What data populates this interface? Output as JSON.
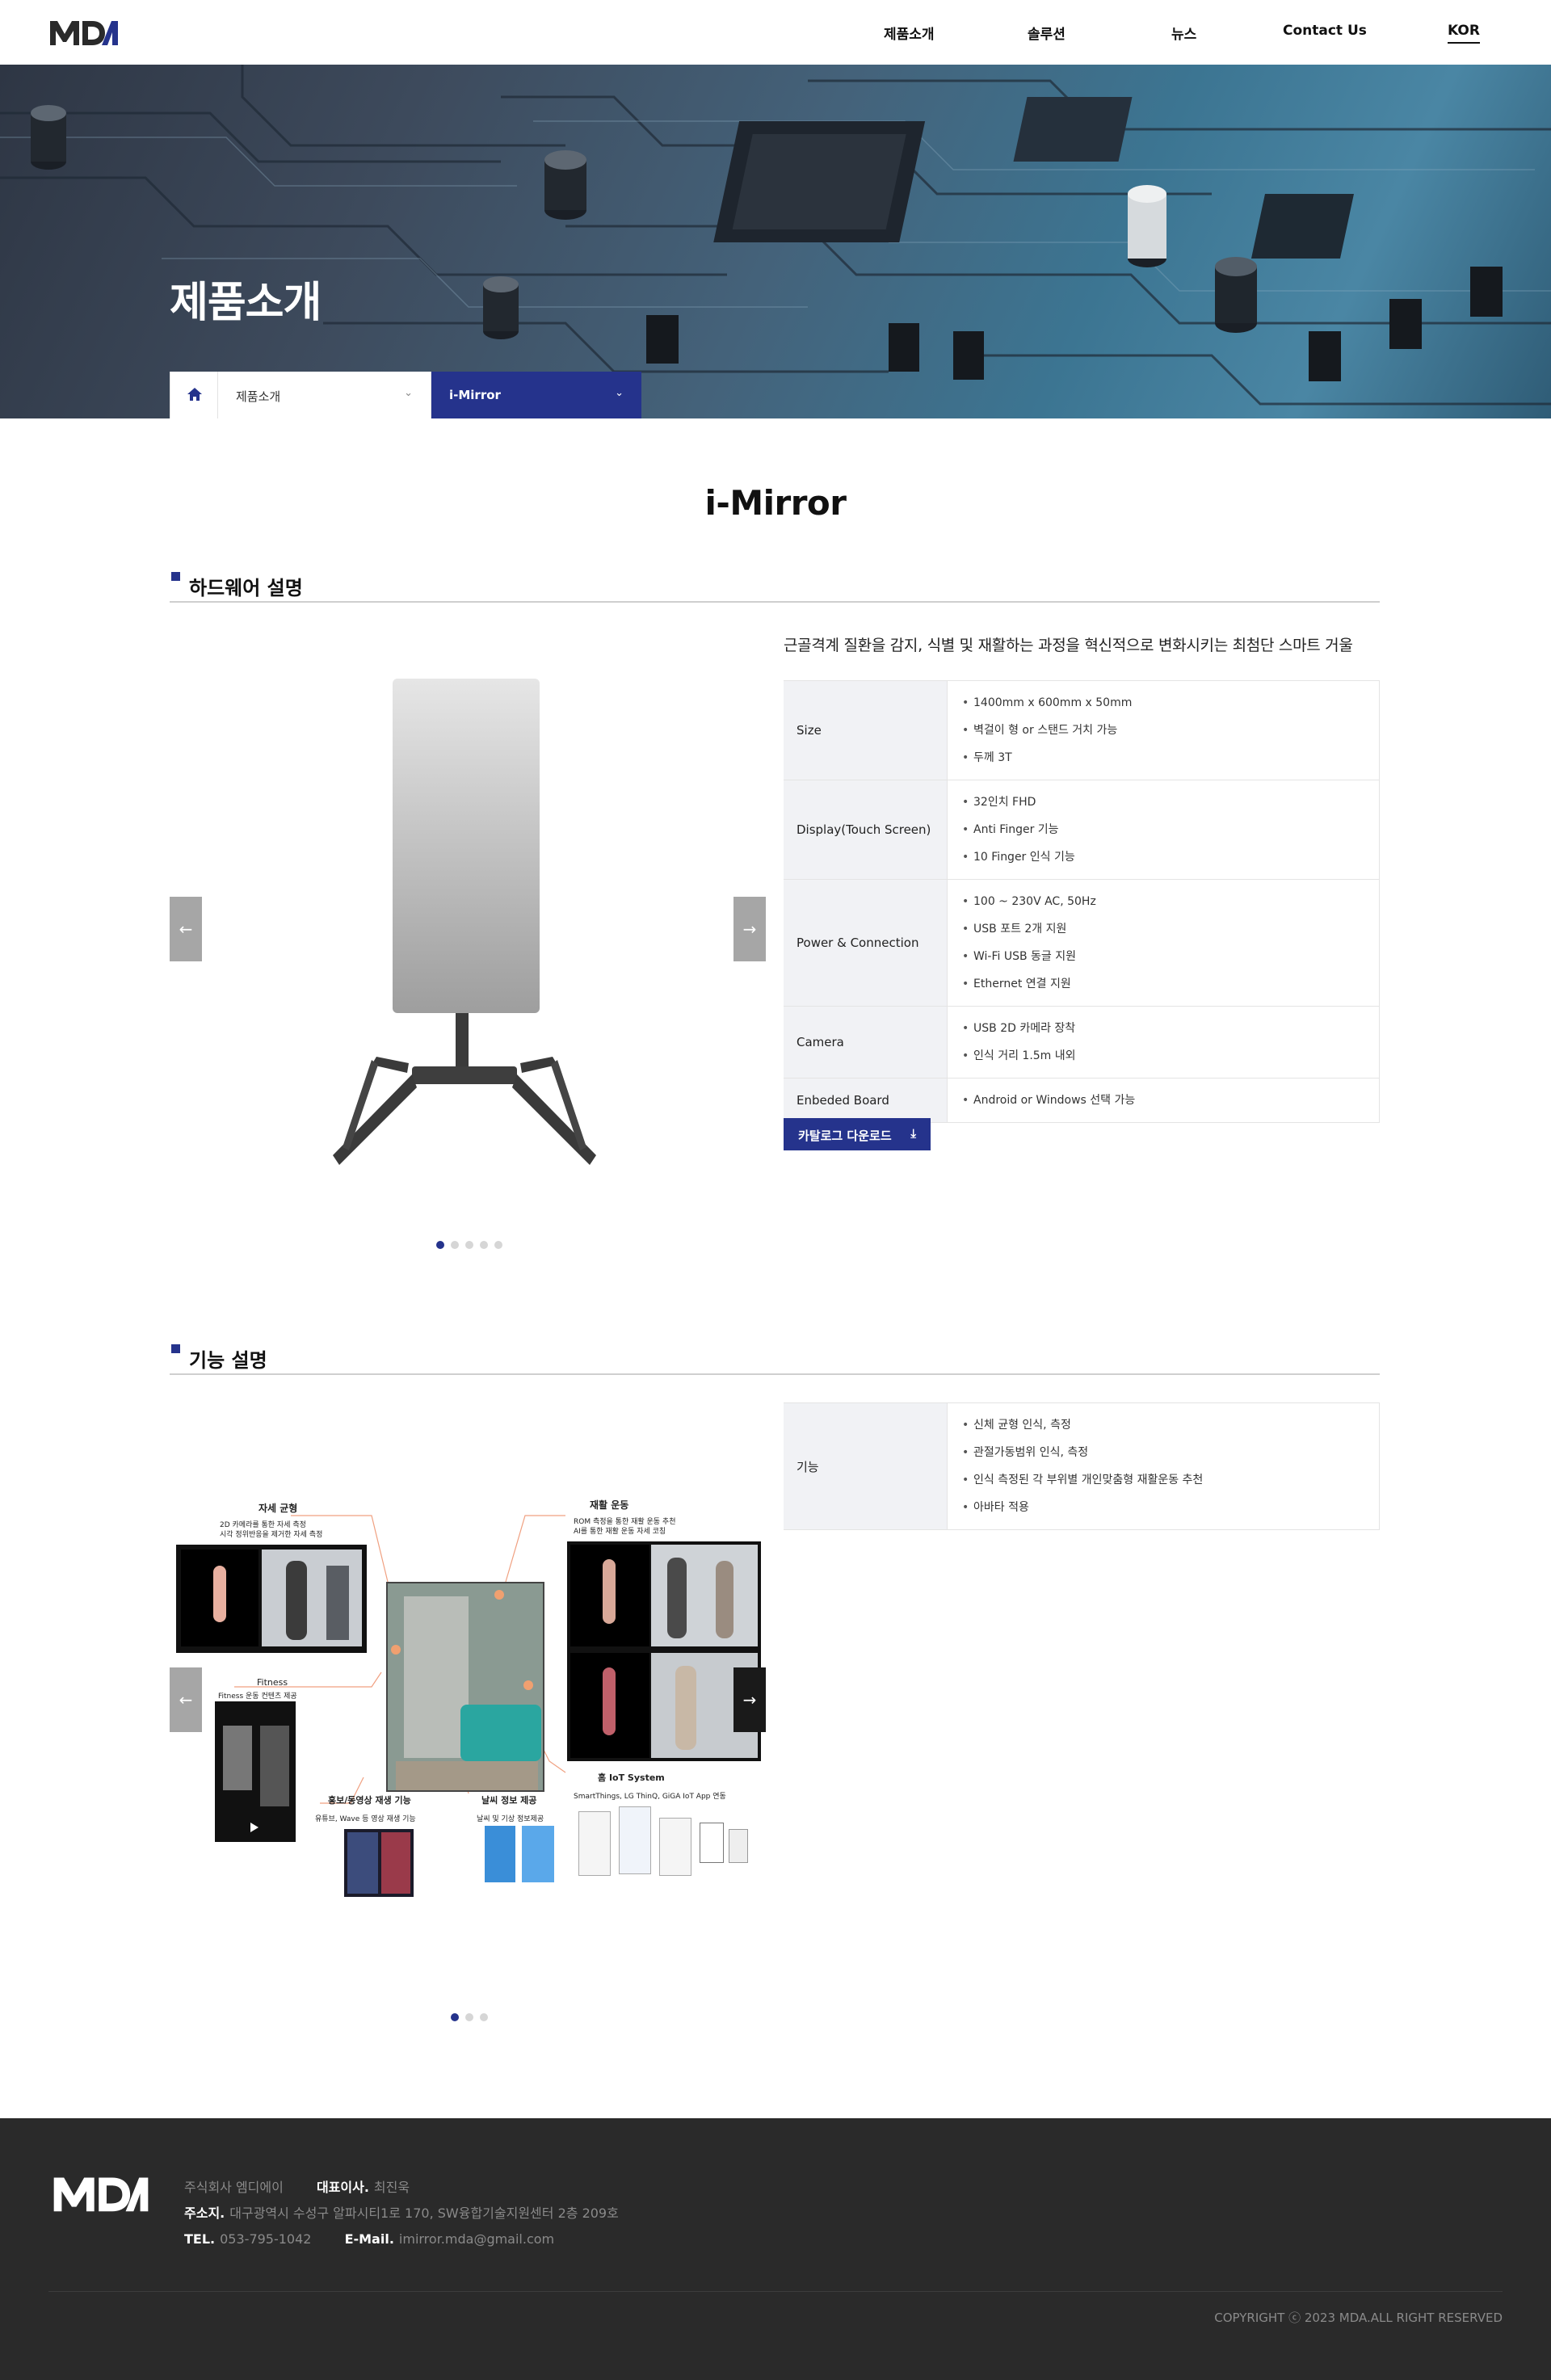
{
  "header": {
    "logo_text": "MDA",
    "nav": [
      "제품소개",
      "솔루션",
      "뉴스",
      "Contact Us"
    ],
    "lang": "KOR"
  },
  "hero": {
    "title": "제품소개"
  },
  "breadcrumb": {
    "level1": "제품소개",
    "level2": "i-Mirror"
  },
  "page_title": "i-Mirror",
  "hardware": {
    "heading": "하드웨어 설명",
    "description": "근골격계 질환을 감지, 식별 및 재활하는 과정을 혁신적으로 변화시키는 최첨단 스마트 거울",
    "slides_total": 5,
    "slide_active": 1,
    "specs": [
      {
        "label": "Size",
        "items": [
          "1400mm x 600mm x 50mm",
          "벽걸이 형 or 스탠드 거치 가능",
          "두께 3T"
        ]
      },
      {
        "label": "Display(Touch Screen)",
        "items": [
          "32인치 FHD",
          "Anti Finger 기능",
          "10 Finger 인식 기능"
        ]
      },
      {
        "label": "Power & Connection",
        "items": [
          "100 ~ 230V AC, 50Hz",
          "USB 포트 2개 지원",
          "Wi-Fi USB 동글 지원",
          "Ethernet 연결 지원"
        ]
      },
      {
        "label": "Camera",
        "items": [
          "USB 2D 카메라 장착",
          "인식 거리 1.5m 내외"
        ]
      },
      {
        "label": "Enbeded Board",
        "items": [
          "Android or Windows 선택 가능"
        ]
      }
    ],
    "download_label": "카탈로그 다운로드"
  },
  "features": {
    "heading": "기능 설명",
    "slides_total": 3,
    "slide_active": 1,
    "table": [
      {
        "label": "기능",
        "items": [
          "신체 균형 인식, 측정",
          "관절가동범위 인식, 측정",
          "인식 측정된 각 부위별 개인맞춤형 재활운동 추천",
          "아바타 적용"
        ]
      }
    ],
    "diagram": {
      "posture_title": "자세 균형",
      "posture_items": [
        "2D 카메라를 통한 자세 측정",
        "시각 정위반응을 제거한 자세 측정"
      ],
      "rehab_title": "재활 운동",
      "rehab_items": [
        "ROM 측정을 통한 재활 운동 추천",
        "AI를 통한 재활 운동 자세 코칭"
      ],
      "fitness_title": "Fitness",
      "fitness_items": [
        "Fitness 운동 컨텐츠 제공"
      ],
      "promo_title": "홍보/동영상 재생 기능",
      "promo_items": [
        "유튜브, Wave 등 영상 재생 기능"
      ],
      "weather_title": "날씨 정보 제공",
      "weather_items": [
        "날씨 및 기상 정보제공"
      ],
      "iot_title": "홈 IoT System",
      "iot_items": [
        "SmartThings, LG ThinQ, GiGA IoT App 연동"
      ]
    }
  },
  "footer": {
    "company": "주식회사 엠디에이",
    "ceo_label": "대표이사.",
    "ceo": "최진욱",
    "addr_label": "주소지.",
    "addr": "대구광역시 수성구 알파시티1로 170, SW융합기술지원센터 2층 209호",
    "tel_label": "TEL.",
    "tel": "053-795-1042",
    "email_label": "E-Mail.",
    "email": "imirror.mda@gmail.com",
    "copyright": "COPYRIGHT ⓒ 2023 MDA.ALL RIGHT RESERVED"
  },
  "colors": {
    "brand": "#25338c",
    "footer_bg": "#2a2a2a",
    "table_header_bg": "#f1f2f5"
  }
}
